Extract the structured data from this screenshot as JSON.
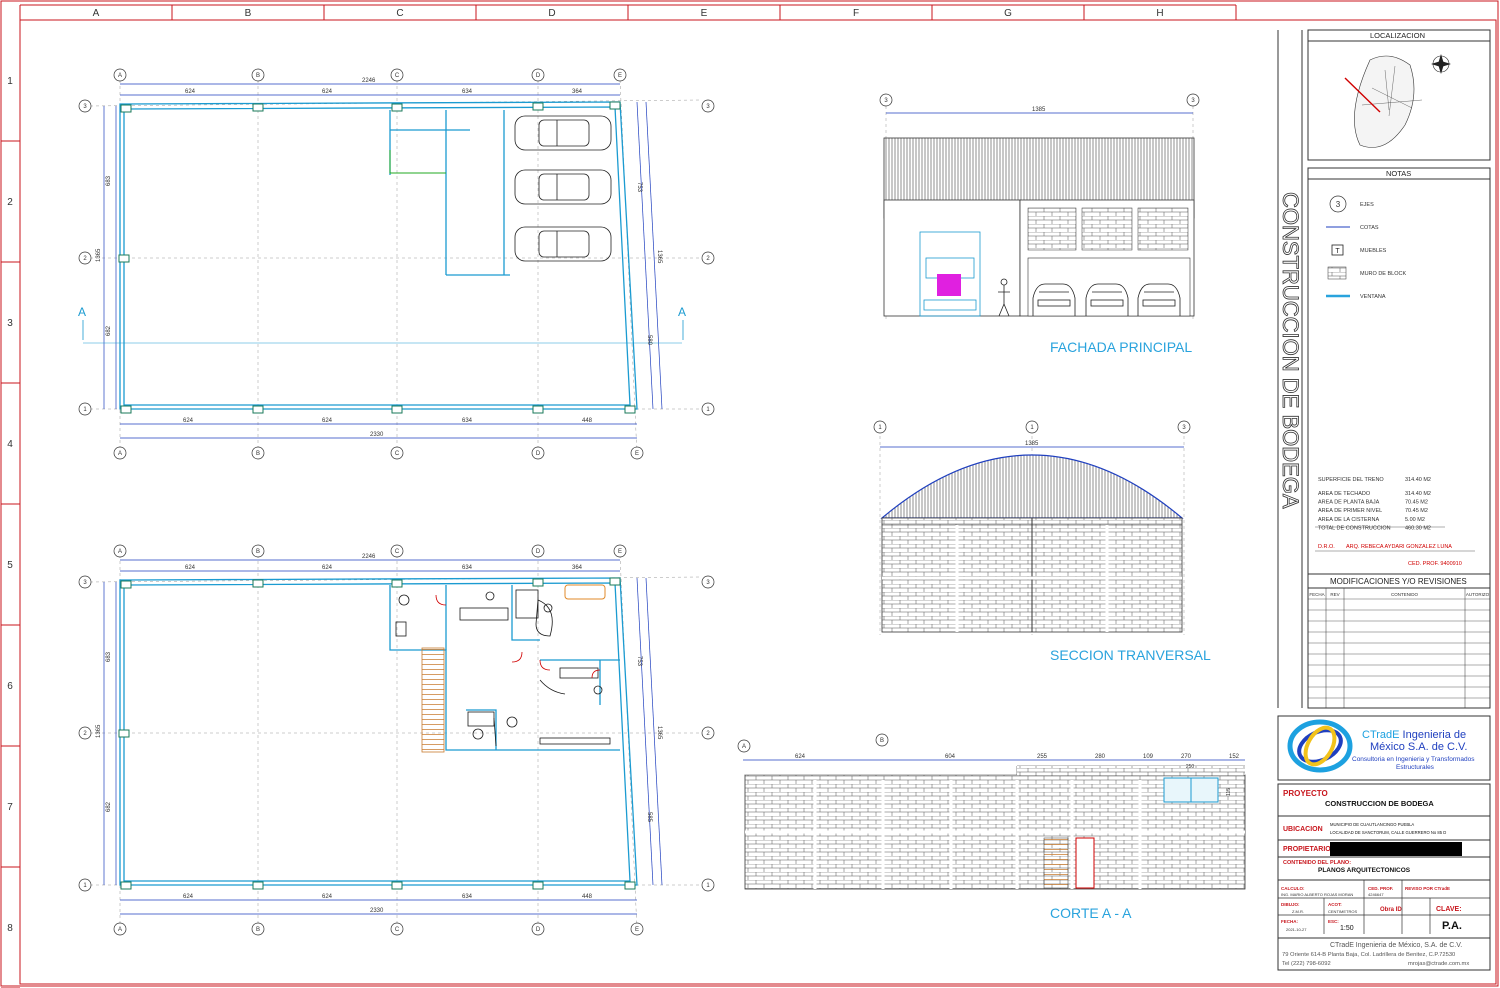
{
  "grid_frame": {
    "columns": [
      "A",
      "B",
      "C",
      "D",
      "E",
      "F",
      "G",
      "H"
    ],
    "rows": [
      "1",
      "2",
      "3",
      "4",
      "5",
      "6",
      "7",
      "8"
    ]
  },
  "plan_top": {
    "axes_x": [
      "A",
      "B",
      "C",
      "D",
      "E"
    ],
    "axes_y": [
      "3",
      "2",
      "1"
    ],
    "dims_top_total": "2246",
    "dims_top": [
      "624",
      "624",
      "634",
      "364"
    ],
    "dims_bottom": [
      "624",
      "624",
      "634",
      "448"
    ],
    "dims_bottom_total": "2330",
    "dims_left": [
      "683",
      "682"
    ],
    "dims_left_total": "1365",
    "dims_right": [
      "753",
      "1365",
      "580"
    ],
    "section_mark": "A"
  },
  "plan_bottom": {
    "axes_x": [
      "A",
      "B",
      "C",
      "D",
      "E"
    ],
    "axes_y": [
      "3",
      "2",
      "1"
    ],
    "dims_top_total": "2246",
    "dims_top": [
      "624",
      "624",
      "634",
      "364"
    ],
    "dims_bottom": [
      "624",
      "624",
      "634",
      "448"
    ],
    "dims_bottom_total": "2330",
    "dims_left": [
      "683",
      "682"
    ],
    "dims_left_total": "1365",
    "dims_right": [
      "753",
      "1365",
      "585"
    ]
  },
  "fachada": {
    "title": "FACHADA PRINCIPAL",
    "dim": "1385",
    "axes": [
      "3",
      "3"
    ]
  },
  "seccion": {
    "title": "SECCION TRANVERSAL",
    "dim": "1385",
    "axes": [
      "1",
      "1",
      "3"
    ]
  },
  "corte": {
    "title": "CORTE A - A",
    "axes": [
      "A",
      "B"
    ],
    "dims": [
      "624",
      "604",
      "255",
      "280",
      "109",
      "270",
      "152"
    ],
    "sub_dims": [
      "250",
      "115"
    ]
  },
  "titleblock": {
    "vertical_title": "CONSTRUCCION DE BODEGA",
    "localizacion": "LOCALIZACION",
    "notas": "NOTAS",
    "notes": [
      {
        "icon": "axis-icon",
        "glyph": "3",
        "label": "EJES"
      },
      {
        "icon": "dimension-icon",
        "glyph": "",
        "label": "COTAS"
      },
      {
        "icon": "furniture-icon",
        "glyph": "T",
        "label": "MUEBLES"
      },
      {
        "icon": "block-wall-icon",
        "glyph": "",
        "label": "MURO DE BLOCK"
      },
      {
        "icon": "window-icon",
        "glyph": "",
        "label": "VENTANA"
      }
    ],
    "areas": [
      {
        "label": "SUPERFICIE DEL TRENO",
        "value": "314.40 M2"
      },
      {
        "label": "AREA DE TECHADO",
        "value": "314.40 M2"
      },
      {
        "label": "AREA DE PLANTA BAJA",
        "value": "70.45 M2"
      },
      {
        "label": "AREA DE PRIMER NIVEL",
        "value": "70.45 M2"
      },
      {
        "label": "AREA DE LA CISTERNA",
        "value": "5.00 M2"
      },
      {
        "label": "TOTAL DE CONSTRUCCION",
        "value": "460.30 M2"
      }
    ],
    "dro_label": "D.R.O.",
    "dro_name": "ARQ. REBECA AYDARI GONZALEZ LUNA",
    "ced_prof": "CED. PROF. 9400910",
    "modificaciones": "MODIFICACIONES Y/O REVISIONES",
    "mod_cols": [
      "FECHA",
      "REV",
      "CONTENIDO",
      "AUTORIZO"
    ],
    "company_name": "CTradE Ingenieria de México S.A. de C.V.",
    "company_sub": "Consultoria en Ingenieria y Transformados Estructurales",
    "proyecto_label": "PROYECTO",
    "proyecto_value": "CONSTRUCCION DE BODEGA",
    "ubicacion_label": "UBICACION",
    "ubicacion_line1": "MUNICIPIO DE CUAUTLANCINGO PUEBLA",
    "ubicacion_line2": "LOCALIDAD DE SANCTORUM, CALLE GUERRERO No 85 D",
    "propietario_label": "PROPIETARIO",
    "contenido_label": "CONTENIDO DEL PLANO:",
    "contenido_value": "PLANOS ARQUITECTONICOS",
    "calculo_label": "CALCULO:",
    "calculo_value": "ING. MARIO ALBERTO ROJAS MORAN",
    "ced_prof2_label": "CED. PROF.",
    "ced_prof2_value": "4246647",
    "reviso_label": "REVISO POR CTradE",
    "dibujo_label": "DIBUJO:",
    "dibujo_value": "Z.M.R.",
    "acot_label": "ACOT:",
    "acot_value": "CENTIMETROS",
    "obra_label": "Obra ID",
    "clave_label": "CLAVE:",
    "clave_value": "P.A.",
    "fecha_label": "FECHA:",
    "fecha_value": "2021-10-27",
    "esc_label": "ESC:",
    "esc_value": "1:50",
    "footer1": "CTradE Ingenieria de México, S.A. de C.V.",
    "footer2": "79 Oriente 614-B Planta Baja, Col. Ladrillera de Benitez, C.P.72530",
    "footer3": "Tel (222) 798-6092",
    "footer4": "mrojas@ctrade.com.mx"
  },
  "colors": {
    "frame": "#c8161d",
    "wall": "#1b9bd1",
    "dim": "#1f3fbf",
    "axis": "#555555",
    "furniture": "#1a1a1a",
    "accent_green": "#22aa22",
    "stair": "#c87a2e",
    "magenta": "#e020e0"
  }
}
